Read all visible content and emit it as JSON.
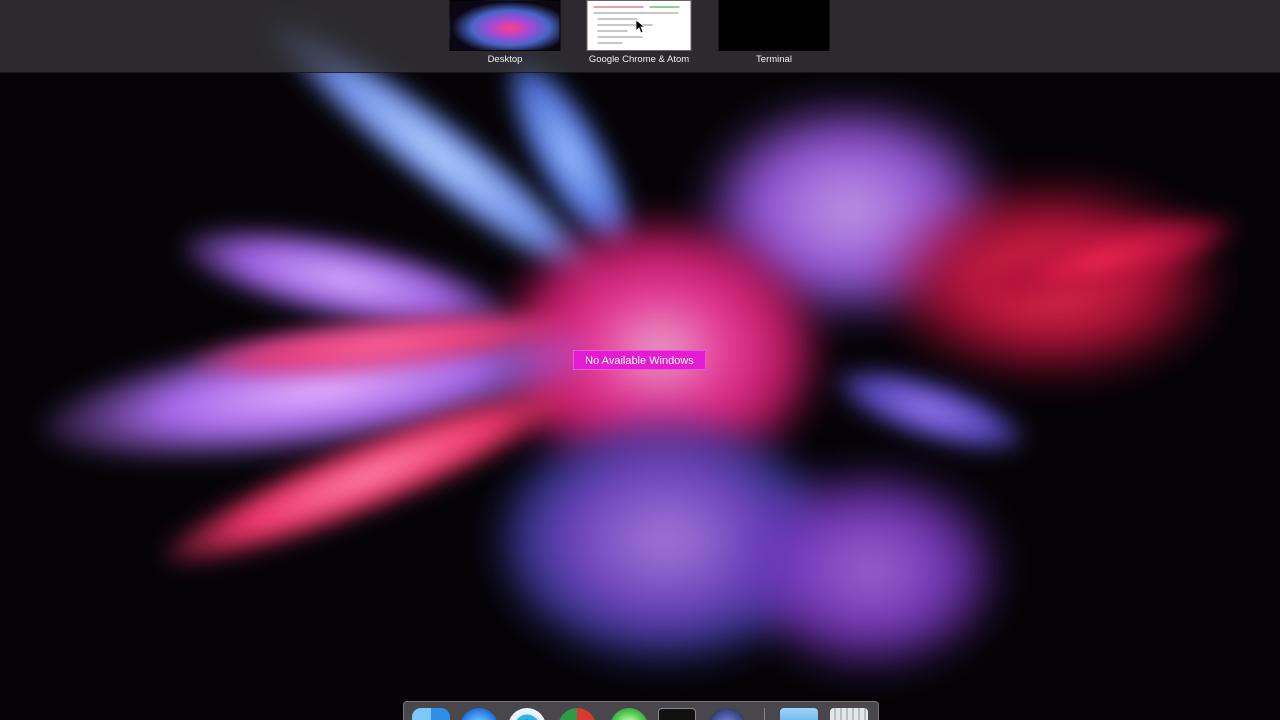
{
  "spaces": [
    {
      "label": "Desktop"
    },
    {
      "label": "Google Chrome & Atom"
    },
    {
      "label": "Terminal"
    }
  ],
  "notice": {
    "text": "No Available Windows"
  },
  "dock": {
    "icons": [
      {
        "name": "finder-icon",
        "color": "#3aa8f0"
      },
      {
        "name": "safari-icon",
        "color": "#2d7fe0"
      },
      {
        "name": "spotlight-app-icon",
        "color": "#2fb2e4"
      },
      {
        "name": "chrome-icon",
        "color": "#d83a30"
      },
      {
        "name": "messages-icon",
        "color": "#5fd25a"
      },
      {
        "name": "terminal-icon",
        "color": "#1a1a1a"
      },
      {
        "name": "generic-app-icon",
        "color": "#3a4b8a"
      },
      {
        "name": "downloads-folder-icon",
        "color": "#4aa8e8"
      },
      {
        "name": "trash-icon",
        "color": "#c9cdd2"
      }
    ]
  },
  "colors": {
    "notice_bg": "#e51bd1",
    "spaces_bar": "#3c3a40"
  }
}
